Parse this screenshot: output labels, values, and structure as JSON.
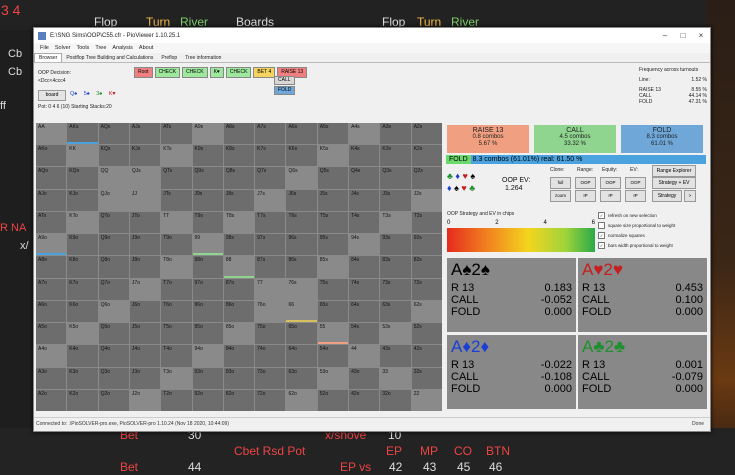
{
  "background": {
    "left_labels": [
      "3 4",
      "Cb",
      "Cb",
      "ff",
      "R NA",
      "x/"
    ],
    "top_labels": [
      "Flop",
      "Turn",
      "River",
      "Boards",
      "Flop",
      "Turn",
      "River"
    ],
    "bottom": {
      "bet_label_1": "Bet",
      "bet_val_1": "30",
      "bet_label_2": "Bet",
      "bet_val_2": "44",
      "xshove": "x/shove",
      "xshove_val": "10",
      "cbet": "Cbet Rsd Pot",
      "headers": [
        "EP",
        "MP",
        "CO",
        "BTN"
      ],
      "ep_vs": "EP vs",
      "values": [
        "42",
        "43",
        "45",
        "46"
      ]
    }
  },
  "window": {
    "title": "E:\\SNG Sims\\OOP\\C55.cfr - PioViewer 1.10.25.1",
    "menu": [
      "File",
      "Solver",
      "Tools",
      "Tree",
      "Analysis",
      "About"
    ],
    "tabs": [
      "Browser",
      "Postflop Tree Building and Calculations",
      "Preflop",
      "Tree information"
    ],
    "decision_label": "OOP Decision:",
    "decision_line": "<Dcc<4ccc4",
    "board_button": "board",
    "board_cards": [
      "Q♠",
      "5♠",
      "3♠",
      "K♥"
    ],
    "pot_line": "Pot: 0 4 6 (10) Starting Stacks:20",
    "path": [
      {
        "label": "Root",
        "color": "#f08080"
      },
      {
        "label": "CHECK",
        "color": "#9de89d"
      },
      {
        "label": "CHECK",
        "color": "#9de89d"
      },
      {
        "label": "K♥",
        "color": "#9de89d"
      },
      {
        "label": "CHECK",
        "color": "#9de89d"
      },
      {
        "label": "BET 4",
        "color": "#f4d35e"
      },
      {
        "label": "RAISE 13",
        "color": "#f08080"
      }
    ],
    "sub_actions": {
      "call": "CALL",
      "fold": "FOLD"
    },
    "freq": {
      "title": "Frequency across turnouts",
      "line_label": "Line:",
      "line_value": "1.52 %",
      "rows": [
        {
          "k": "RAISE 13",
          "v": "8.55 %"
        },
        {
          "k": "CALL",
          "v": "44.14 %"
        },
        {
          "k": "FOLD",
          "v": "47.31 %"
        }
      ]
    },
    "status": "Connected to: .\\PioSOLVER-pro.exe, PioSOLVER-pro 1.10.24 (Nov 18 2020, 10:44:09)",
    "status_right": "Done"
  },
  "grid": [
    [
      "AA",
      "AKs",
      "AQs",
      "AJs",
      "ATs",
      "A9s",
      "A8s",
      "A7s",
      "A6s",
      "A5s",
      "A4s",
      "A3s",
      "A2s"
    ],
    [
      "AKo",
      "KK",
      "KQs",
      "KJs",
      "KTs",
      "K9s",
      "K8s",
      "K7s",
      "K6s",
      "K5s",
      "K4s",
      "K3s",
      "K2s"
    ],
    [
      "AQo",
      "KQo",
      "QQ",
      "QJs",
      "QTs",
      "Q9s",
      "Q8s",
      "Q7s",
      "Q6s",
      "Q5s",
      "Q4s",
      "Q3s",
      "Q2s"
    ],
    [
      "AJo",
      "KJo",
      "QJo",
      "JJ",
      "JTs",
      "J9s",
      "J8s",
      "J7s",
      "J6s",
      "J5s",
      "J4s",
      "J3s",
      "J2s"
    ],
    [
      "ATo",
      "KTo",
      "QTo",
      "JTo",
      "TT",
      "T9s",
      "T8s",
      "T7s",
      "T6s",
      "T5s",
      "T4s",
      "T3s",
      "T2s"
    ],
    [
      "A9o",
      "K9o",
      "Q9o",
      "J9o",
      "T9o",
      "99",
      "98s",
      "97s",
      "96s",
      "95s",
      "94s",
      "93s",
      "92s"
    ],
    [
      "A8o",
      "K8o",
      "Q8o",
      "J8o",
      "T8o",
      "98o",
      "88",
      "87s",
      "86s",
      "85s",
      "84s",
      "83s",
      "82s"
    ],
    [
      "A7o",
      "K7o",
      "Q7o",
      "J7o",
      "T7o",
      "97o",
      "87o",
      "77",
      "76s",
      "75s",
      "74s",
      "73s",
      "72s"
    ],
    [
      "A6o",
      "K6o",
      "Q6o",
      "J6o",
      "T6o",
      "96o",
      "86o",
      "76o",
      "66",
      "65s",
      "64s",
      "63s",
      "62s"
    ],
    [
      "A5o",
      "K5o",
      "Q5o",
      "J5o",
      "T5o",
      "95o",
      "85o",
      "75o",
      "65o",
      "55",
      "54s",
      "53s",
      "52s"
    ],
    [
      "A4o",
      "K4o",
      "Q4o",
      "J4o",
      "T4o",
      "94o",
      "84o",
      "74o",
      "64o",
      "54o",
      "44",
      "43s",
      "42s"
    ],
    [
      "A3o",
      "K3o",
      "Q3o",
      "J3o",
      "T3o",
      "93o",
      "83o",
      "73o",
      "63o",
      "53o",
      "43o",
      "33",
      "32s"
    ],
    [
      "A2o",
      "K2o",
      "Q2o",
      "J2o",
      "T2o",
      "92o",
      "82o",
      "72o",
      "62o",
      "52o",
      "42o",
      "32o",
      "22"
    ]
  ],
  "summary": [
    {
      "action": "RAISE 13",
      "combos": "0.8 combos",
      "pct": "5.67 %",
      "color": "#f0a080"
    },
    {
      "action": "CALL",
      "combos": "4.5 combos",
      "pct": "33.32 %",
      "color": "#8fd48f"
    },
    {
      "action": "FOLD",
      "combos": "8.3 combos",
      "pct": "61.01 %",
      "color": "#6fa8d8"
    }
  ],
  "fold_bar": {
    "left": "FOLD",
    "text": "8.3 combos (61.01%) real: 61.50 %"
  },
  "oop_ev": {
    "label": "OOP EV:",
    "value": "1.264"
  },
  "option_labels": {
    "clone": "Clone:",
    "range": "Range:",
    "equity": "Equity:",
    "ev": "EV:"
  },
  "buttons": {
    "full": "full",
    "zoom": "zoom",
    "oop1": "OOP",
    "ip1": "IP",
    "oop2": "OOP",
    "ip2": "IP",
    "oop3": "OOP",
    "ip3": "IP",
    "range_explorer": "Range Explorer",
    "strategy_ev": "Strategy + EV",
    "strategy": "Strategy",
    "arrow": ">"
  },
  "checks": [
    {
      "label": "refresh on new selection",
      "checked": true
    },
    {
      "label": "square size proportional to weight",
      "checked": false
    },
    {
      "label": "normalize squares",
      "checked": true
    },
    {
      "label": "bars width proportional to weight",
      "checked": true
    }
  ],
  "ev_scale": {
    "title": "OOP Strategy and EV in chips",
    "ticks": [
      "0",
      "2",
      "4",
      "6"
    ]
  },
  "hands": [
    {
      "cards": "A♠2♠",
      "suit_color": "#000000",
      "r": "0.183",
      "call": "-0.052",
      "fold": "0.000"
    },
    {
      "cards": "A♥2♥",
      "suit_color": "#c41e1e",
      "r": "0.453",
      "call": "0.100",
      "fold": "0.000"
    },
    {
      "cards": "A♦2♦",
      "suit_color": "#1a3fd6",
      "r": "-0.022",
      "call": "-0.108",
      "fold": "0.000"
    },
    {
      "cards": "A♣2♣",
      "suit_color": "#1f8f2f",
      "r": "0.001",
      "call": "-0.079",
      "fold": "0.000"
    }
  ],
  "hand_row_labels": {
    "r": "R 13",
    "call": "CALL",
    "fold": "FOLD"
  }
}
